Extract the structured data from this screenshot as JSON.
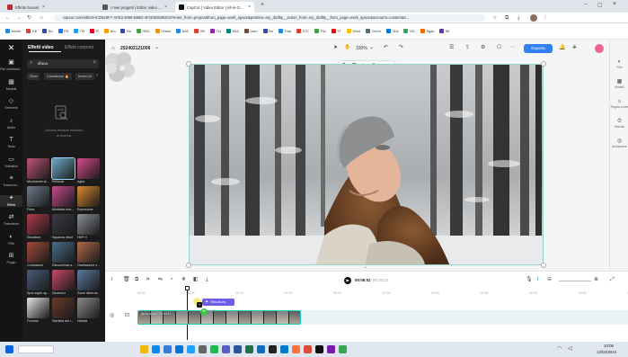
{
  "browser": {
    "tabs": [
      {
        "title": "Effetto bosoni: cos'è e come u...",
        "icon_color": "#c62828",
        "active": false
      },
      {
        "title": "I miei progetti | Editor video ...",
        "icon_color": "#555555",
        "active": false
      },
      {
        "title": "CapCut | Video Editor | All-in-O...",
        "icon_color": "#111111",
        "active": true
      }
    ],
    "new_tab": "+",
    "url": "capcut.com/editor/ACD820F7-AFE3-4099-B86D-4F2E0D5992C6?enter_from=project&from_page=work_space&position=my_draft&__action_from=my_draft&__from_page=work_space&scenario=custom&s...",
    "bookmarks": [
      {
        "label": "Anime",
        "color": "#1e88e5"
      },
      {
        "label": "GE",
        "color": "#e53935"
      },
      {
        "label": "Ra",
        "color": "#3949ab"
      },
      {
        "label": "FB",
        "color": "#1877f2"
      },
      {
        "label": "TW",
        "color": "#1da1f2"
      },
      {
        "label": "Pi",
        "color": "#e60023"
      },
      {
        "label": "Am",
        "color": "#ff9900"
      },
      {
        "label": "Ra",
        "color": "#3949ab"
      },
      {
        "label": "GRC",
        "color": "#43a047"
      },
      {
        "label": "GNoto",
        "color": "#fb8c00"
      },
      {
        "label": "AdS",
        "color": "#1e88e5"
      },
      {
        "label": "GN",
        "color": "#e53935"
      },
      {
        "label": "Fry",
        "color": "#8e24aa"
      },
      {
        "label": "WIA",
        "color": "#00897b"
      },
      {
        "label": "Gam",
        "color": "#6d4c41"
      },
      {
        "label": "Ra",
        "color": "#3949ab"
      },
      {
        "label": "Trad",
        "color": "#1e88e5"
      },
      {
        "label": "STC",
        "color": "#e53935"
      },
      {
        "label": "Flw",
        "color": "#43a047"
      },
      {
        "label": "YT",
        "color": "#ff0000"
      },
      {
        "label": "Drive",
        "color": "#fbbc04"
      },
      {
        "label": "OnOn",
        "color": "#546e7a"
      },
      {
        "label": "Outl",
        "color": "#0078d4"
      },
      {
        "label": "GD",
        "color": "#34a853"
      },
      {
        "label": "Tigas",
        "color": "#ef6c00"
      },
      {
        "label": "Sit",
        "color": "#5e35b1"
      }
    ]
  },
  "sidebar_nav": [
    {
      "label": "File multimed...",
      "glyph": "▣"
    },
    {
      "label": "Modelli",
      "glyph": "▦"
    },
    {
      "label": "Elementi",
      "glyph": "◇"
    },
    {
      "label": "Audio",
      "glyph": "♪"
    },
    {
      "label": "Testo",
      "glyph": "T"
    },
    {
      "label": "Sottotitoli",
      "glyph": "▭"
    },
    {
      "label": "Trascrizio...",
      "glyph": "≡"
    },
    {
      "label": "Effetti",
      "glyph": "✦"
    },
    {
      "label": "Transizioni",
      "glyph": "⇄"
    },
    {
      "label": "Filtri",
      "glyph": "◐"
    },
    {
      "label": "Plugin",
      "glyph": "⊞"
    }
  ],
  "panel": {
    "tab_video": "Effetti video",
    "tab_body": "Effetti corporei",
    "search_value": "sfoca",
    "chips": [
      "Sfoci",
      "Countdown",
      "Invern-In"
    ],
    "chip_badge": "🔥",
    "empty_title": "Ancora nessun risultato",
    "empty_sub": "di ricerca",
    "effects": [
      [
        "Movimento sf...",
        "Pellicola",
        "Aglia"
      ],
      [
        "Flora",
        "Minitesta ene...",
        "Esplosione"
      ],
      [
        "Sfocatura",
        "Squarcio sfoct",
        "HDR II"
      ],
      [
        "Confusione",
        "Dissolvenza s...",
        "Oscillazione c..."
      ],
      [
        "Spot super sp...",
        "Dinamico",
        "Zoom aberraz..."
      ],
      [
        "Fulmine",
        "Starfield dei r...",
        "Nebbia"
      ]
    ]
  },
  "editor": {
    "project_name": "202402121006",
    "zoom": "100%",
    "export_label": "Esporta",
    "right_tools": [
      {
        "label": "Filtri",
        "glyph": "◐"
      },
      {
        "label": "Modelli",
        "glyph": "▦"
      },
      {
        "label": "Regola colore",
        "glyph": "☼"
      },
      {
        "label": "Velocità",
        "glyph": "⏱"
      },
      {
        "label": "Animazione",
        "glyph": "◎"
      }
    ]
  },
  "timeline": {
    "time_current": "00:05:02",
    "time_total": "00:10:13",
    "ticks": [
      "00:00",
      "00:05",
      "00:10",
      "00:15",
      "00:20",
      "00:25",
      "00:30",
      "00:35",
      "00:40",
      "00:45",
      "00:50"
    ],
    "effect_clip_label": "Sfocatura",
    "video_clip_label": "girl-in-snow · 00:04:13"
  },
  "taskbar": {
    "time": "10:06",
    "date": "12/02/2024",
    "apps": [
      {
        "name": "windows-start",
        "color": "#0a64d8"
      },
      {
        "name": "search",
        "color": "#444444"
      },
      {
        "name": "file-explorer",
        "color": "#f2b705"
      },
      {
        "name": "edge",
        "color": "#0c8ce9"
      },
      {
        "name": "store",
        "color": "#3a7bd5"
      },
      {
        "name": "mail",
        "color": "#0078d4"
      },
      {
        "name": "photos",
        "color": "#1fa2ff"
      },
      {
        "name": "settings",
        "color": "#666666"
      },
      {
        "name": "spotify",
        "color": "#1db954"
      },
      {
        "name": "teams",
        "color": "#5b5fc7"
      },
      {
        "name": "word",
        "color": "#2b579a"
      },
      {
        "name": "excel",
        "color": "#217346"
      },
      {
        "name": "outlook",
        "color": "#0f6cbd"
      },
      {
        "name": "terminal",
        "color": "#222222"
      },
      {
        "name": "vscode",
        "color": "#007acc"
      },
      {
        "name": "firefox",
        "color": "#ff7139"
      },
      {
        "name": "chrome",
        "color": "#dd4b39"
      },
      {
        "name": "capcut",
        "color": "#111111"
      },
      {
        "name": "onenote",
        "color": "#7719aa"
      },
      {
        "name": "chrome-active",
        "color": "#34a853"
      }
    ]
  }
}
